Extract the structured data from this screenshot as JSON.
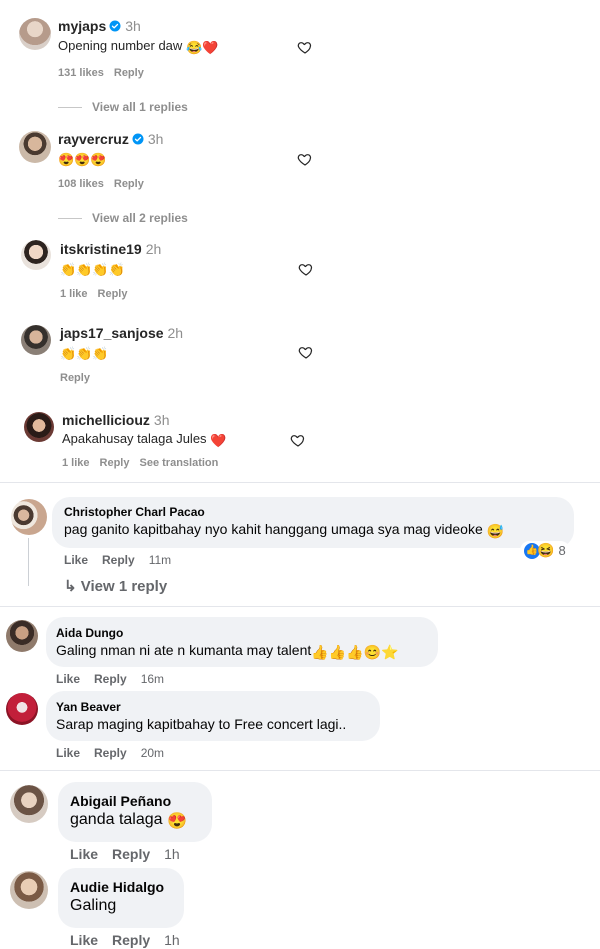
{
  "ig_comments": [
    {
      "user": "myjaps",
      "verified": true,
      "time": "3h",
      "text": "Opening number daw",
      "emoji": "😂❤️",
      "likes": "131 likes",
      "reply": "Reply",
      "view_replies": "View all 1 replies"
    },
    {
      "user": "rayvercruz",
      "verified": true,
      "time": "3h",
      "text": "",
      "emoji": "😍😍😍",
      "likes": "108 likes",
      "reply": "Reply",
      "view_replies": "View all 2 replies"
    },
    {
      "user": "itskristine19",
      "verified": false,
      "time": "2h",
      "text": "",
      "emoji": "👏👏👏👏",
      "likes": "1 like",
      "reply": "Reply"
    },
    {
      "user": "japs17_sanjose",
      "verified": false,
      "time": "2h",
      "text": "",
      "emoji": "👏👏👏",
      "likes": "",
      "reply": "Reply"
    },
    {
      "user": "michelliciouz",
      "verified": false,
      "time": "3h",
      "text": "Apakahusay talaga Jules",
      "emoji": "❤️",
      "likes": "1 like",
      "reply": "Reply",
      "translation": "See translation"
    }
  ],
  "fb_comments": [
    {
      "name": "Christopher Charl Pacao",
      "text": "pag ganito kapitbahay nyo kahit hanggang umaga sya mag videoke",
      "emoji": "😅",
      "like": "Like",
      "reply": "Reply",
      "time": "11m",
      "reactions": "8",
      "view_reply": "View 1 reply"
    },
    {
      "name": "Aida Dungo",
      "text": "Galing nman ni ate n kumanta may talent",
      "emoji": "👍👍👍😊⭐",
      "like": "Like",
      "reply": "Reply",
      "time": "16m"
    },
    {
      "name": "Yan Beaver",
      "text": "Sarap maging kapitbahay to Free concert lagi..",
      "emoji": "",
      "like": "Like",
      "reply": "Reply",
      "time": "20m"
    },
    {
      "name": "Abigail Peñano",
      "text": "ganda talaga",
      "emoji": "😍",
      "like": "Like",
      "reply": "Reply",
      "time": "1h"
    },
    {
      "name": "Audie Hidalgo",
      "text": "Galing",
      "emoji": "",
      "like": "Like",
      "reply": "Reply",
      "time": "1h"
    }
  ],
  "colors": {
    "verified": "#0095f6",
    "heart_stroke": "#262626",
    "fb_bubble": "#f0f2f5",
    "fb_meta": "#65676b",
    "ig_meta": "#8e8e8e"
  },
  "icons": [
    "verified-badge-icon",
    "heart-outline-icon",
    "reply-arrow-icon",
    "like-reaction-icon",
    "haha-reaction-icon"
  ]
}
